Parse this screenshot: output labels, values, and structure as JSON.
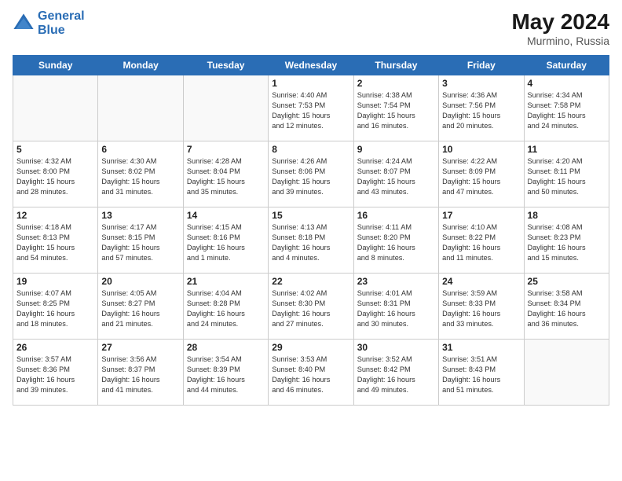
{
  "header": {
    "logo_line1": "General",
    "logo_line2": "Blue",
    "month_year": "May 2024",
    "location": "Murmino, Russia"
  },
  "days_of_week": [
    "Sunday",
    "Monday",
    "Tuesday",
    "Wednesday",
    "Thursday",
    "Friday",
    "Saturday"
  ],
  "weeks": [
    [
      {
        "day": "",
        "info": ""
      },
      {
        "day": "",
        "info": ""
      },
      {
        "day": "",
        "info": ""
      },
      {
        "day": "1",
        "info": "Sunrise: 4:40 AM\nSunset: 7:53 PM\nDaylight: 15 hours\nand 12 minutes."
      },
      {
        "day": "2",
        "info": "Sunrise: 4:38 AM\nSunset: 7:54 PM\nDaylight: 15 hours\nand 16 minutes."
      },
      {
        "day": "3",
        "info": "Sunrise: 4:36 AM\nSunset: 7:56 PM\nDaylight: 15 hours\nand 20 minutes."
      },
      {
        "day": "4",
        "info": "Sunrise: 4:34 AM\nSunset: 7:58 PM\nDaylight: 15 hours\nand 24 minutes."
      }
    ],
    [
      {
        "day": "5",
        "info": "Sunrise: 4:32 AM\nSunset: 8:00 PM\nDaylight: 15 hours\nand 28 minutes."
      },
      {
        "day": "6",
        "info": "Sunrise: 4:30 AM\nSunset: 8:02 PM\nDaylight: 15 hours\nand 31 minutes."
      },
      {
        "day": "7",
        "info": "Sunrise: 4:28 AM\nSunset: 8:04 PM\nDaylight: 15 hours\nand 35 minutes."
      },
      {
        "day": "8",
        "info": "Sunrise: 4:26 AM\nSunset: 8:06 PM\nDaylight: 15 hours\nand 39 minutes."
      },
      {
        "day": "9",
        "info": "Sunrise: 4:24 AM\nSunset: 8:07 PM\nDaylight: 15 hours\nand 43 minutes."
      },
      {
        "day": "10",
        "info": "Sunrise: 4:22 AM\nSunset: 8:09 PM\nDaylight: 15 hours\nand 47 minutes."
      },
      {
        "day": "11",
        "info": "Sunrise: 4:20 AM\nSunset: 8:11 PM\nDaylight: 15 hours\nand 50 minutes."
      }
    ],
    [
      {
        "day": "12",
        "info": "Sunrise: 4:18 AM\nSunset: 8:13 PM\nDaylight: 15 hours\nand 54 minutes."
      },
      {
        "day": "13",
        "info": "Sunrise: 4:17 AM\nSunset: 8:15 PM\nDaylight: 15 hours\nand 57 minutes."
      },
      {
        "day": "14",
        "info": "Sunrise: 4:15 AM\nSunset: 8:16 PM\nDaylight: 16 hours\nand 1 minute."
      },
      {
        "day": "15",
        "info": "Sunrise: 4:13 AM\nSunset: 8:18 PM\nDaylight: 16 hours\nand 4 minutes."
      },
      {
        "day": "16",
        "info": "Sunrise: 4:11 AM\nSunset: 8:20 PM\nDaylight: 16 hours\nand 8 minutes."
      },
      {
        "day": "17",
        "info": "Sunrise: 4:10 AM\nSunset: 8:22 PM\nDaylight: 16 hours\nand 11 minutes."
      },
      {
        "day": "18",
        "info": "Sunrise: 4:08 AM\nSunset: 8:23 PM\nDaylight: 16 hours\nand 15 minutes."
      }
    ],
    [
      {
        "day": "19",
        "info": "Sunrise: 4:07 AM\nSunset: 8:25 PM\nDaylight: 16 hours\nand 18 minutes."
      },
      {
        "day": "20",
        "info": "Sunrise: 4:05 AM\nSunset: 8:27 PM\nDaylight: 16 hours\nand 21 minutes."
      },
      {
        "day": "21",
        "info": "Sunrise: 4:04 AM\nSunset: 8:28 PM\nDaylight: 16 hours\nand 24 minutes."
      },
      {
        "day": "22",
        "info": "Sunrise: 4:02 AM\nSunset: 8:30 PM\nDaylight: 16 hours\nand 27 minutes."
      },
      {
        "day": "23",
        "info": "Sunrise: 4:01 AM\nSunset: 8:31 PM\nDaylight: 16 hours\nand 30 minutes."
      },
      {
        "day": "24",
        "info": "Sunrise: 3:59 AM\nSunset: 8:33 PM\nDaylight: 16 hours\nand 33 minutes."
      },
      {
        "day": "25",
        "info": "Sunrise: 3:58 AM\nSunset: 8:34 PM\nDaylight: 16 hours\nand 36 minutes."
      }
    ],
    [
      {
        "day": "26",
        "info": "Sunrise: 3:57 AM\nSunset: 8:36 PM\nDaylight: 16 hours\nand 39 minutes."
      },
      {
        "day": "27",
        "info": "Sunrise: 3:56 AM\nSunset: 8:37 PM\nDaylight: 16 hours\nand 41 minutes."
      },
      {
        "day": "28",
        "info": "Sunrise: 3:54 AM\nSunset: 8:39 PM\nDaylight: 16 hours\nand 44 minutes."
      },
      {
        "day": "29",
        "info": "Sunrise: 3:53 AM\nSunset: 8:40 PM\nDaylight: 16 hours\nand 46 minutes."
      },
      {
        "day": "30",
        "info": "Sunrise: 3:52 AM\nSunset: 8:42 PM\nDaylight: 16 hours\nand 49 minutes."
      },
      {
        "day": "31",
        "info": "Sunrise: 3:51 AM\nSunset: 8:43 PM\nDaylight: 16 hours\nand 51 minutes."
      },
      {
        "day": "",
        "info": ""
      }
    ]
  ]
}
